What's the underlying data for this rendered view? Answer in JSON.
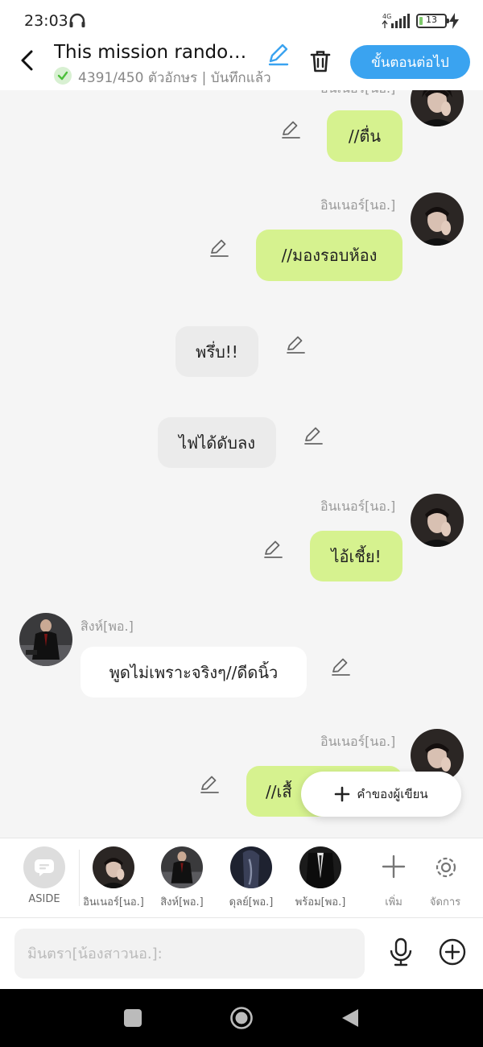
{
  "status_bar": {
    "time": "23:03",
    "network": "4G",
    "battery_level": "13",
    "battery_fraction": 0.13
  },
  "header": {
    "title": "This mission randoml...",
    "char_count": "4391/450 ตัวอักษร | บันทึกแล้ว",
    "next_button": "ขั้นตอนต่อไป"
  },
  "chat": {
    "top_name_partial": "อินเนอร์[นอ.]",
    "messages": [
      {
        "text": "//ตื่น"
      },
      {
        "name": "อินเนอร์[นอ.]",
        "text": "//มองรอบห้อง"
      },
      {
        "text": "พรึ่บ!!"
      },
      {
        "text": "ไฟได้ดับลง"
      },
      {
        "name": "อินเนอร์[นอ.]",
        "text": "ไอ้เชี้ย!"
      },
      {
        "name": "สิงห์[พอ.]",
        "text": "พูดไม่เพราะจริงๆ//ดีดนิ้ว"
      },
      {
        "name": "อินเนอร์[นอ.]",
        "text": "//เสื้"
      }
    ],
    "author_note_label": "คำของผู้เขียน"
  },
  "character_bar": {
    "aside_label": "ASIDE",
    "characters": [
      {
        "label": "อินเนอร์[นอ.]"
      },
      {
        "label": "สิงห์[พอ.]"
      },
      {
        "label": "ดุลย์[พอ.]"
      },
      {
        "label": "พร้อม[พอ.]"
      }
    ],
    "add_label": "เพิ่ม",
    "manage_label": "จัดการ"
  },
  "input": {
    "placeholder": "มินตรา[น้องสาวนอ.]:"
  },
  "colors": {
    "accent": "#3aa3f0",
    "bubble_green": "#d6f28f",
    "check_green": "#4cbf3a"
  },
  "icons": [
    "headphone-icon",
    "signal-icon",
    "bolt-icon",
    "back-arrow-icon",
    "pencil-icon",
    "check-icon",
    "trash-icon",
    "plus-icon",
    "chat-icon",
    "gear-icon",
    "microphone-icon",
    "add-circle-icon"
  ]
}
